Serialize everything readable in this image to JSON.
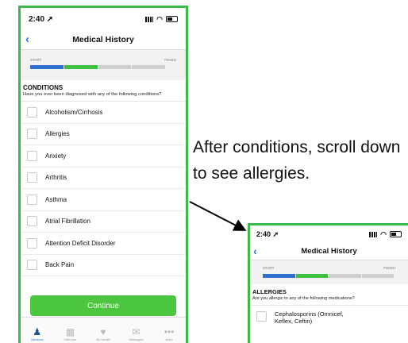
{
  "colors": {
    "frame": "#3cb94a",
    "progress_blue": "#2f6fcf",
    "progress_green": "#3fbf3f",
    "progress_gray": "#cfcfcf",
    "accent": "#1f7bf2",
    "continue_bg": "#4cc53f"
  },
  "phone1": {
    "status_time": "2:40",
    "nav_title": "Medical History",
    "progress": {
      "start_label": "START",
      "finish_label": "FINISH",
      "completed_fraction": 0.4
    },
    "section": {
      "title": "CONDITIONS",
      "prompt": "Have you ever been diagnosed with any of the following conditions?"
    },
    "conditions": [
      "Alcoholism/Cirrhosis",
      "Allergies",
      "Anxiety",
      "Arthritis",
      "Asthma",
      "Atrial Fibrillation",
      "Attention Deficit Disorder",
      "Back Pain"
    ],
    "continue_label": "Continue",
    "tabs": [
      {
        "label": "Services",
        "icon": "person-icon",
        "active": true
      },
      {
        "label": "Calendar",
        "icon": "calendar-icon",
        "active": false
      },
      {
        "label": "My Health",
        "icon": "heart-icon",
        "active": false
      },
      {
        "label": "Messages",
        "icon": "envelope-icon",
        "active": false
      },
      {
        "label": "More",
        "icon": "more-icon",
        "active": false
      }
    ]
  },
  "caption": "After conditions, scroll down to see allergies.",
  "phone2": {
    "status_time": "2:40",
    "nav_title": "Medical History",
    "progress": {
      "start_label": "START",
      "finish_label": "FINISH"
    },
    "section": {
      "title": "ALLERGIES",
      "prompt": "Are you allergic to any of the following medications?"
    },
    "allergies": [
      "Cephalosporins (Omnicef,\nKeflex, Ceftin)"
    ]
  }
}
